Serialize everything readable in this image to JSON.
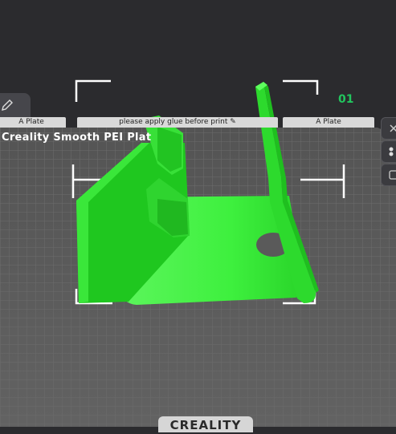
{
  "plate": {
    "number": "01",
    "name": "Creality Smooth PEI Plat",
    "tab_left": "A Plate",
    "tab_center": "please apply glue before print",
    "tab_right": "A Plate"
  },
  "brand": {
    "logo_text": "CREALITY"
  },
  "icons": {
    "edit": "pencil-icon",
    "close": "close-icon",
    "arrange": "arrange-icon",
    "more": "more-icon",
    "tab_edit": "edit-icon"
  },
  "colors": {
    "background": "#2b2b2e",
    "bed": "#595959",
    "grid": "#6b6b6b",
    "model": "#22e022",
    "accent": "#22c55e",
    "selection": "#ffffff"
  }
}
